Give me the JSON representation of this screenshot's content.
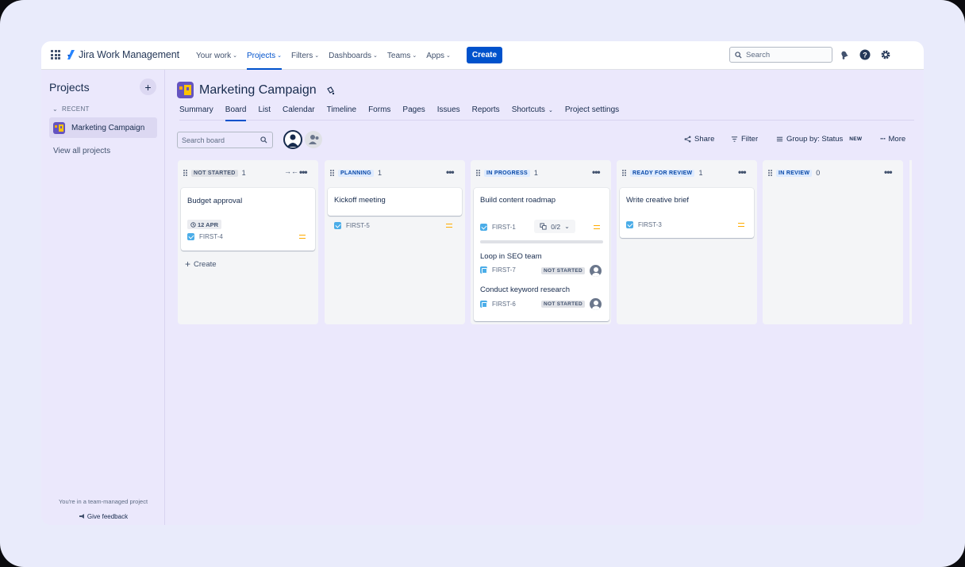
{
  "app": {
    "name": "Jira Work Management"
  },
  "nav": {
    "items": [
      {
        "label": "Your work",
        "chev": "⌄"
      },
      {
        "label": "Projects",
        "chev": "⌄"
      },
      {
        "label": "Filters",
        "chev": "⌄"
      },
      {
        "label": "Dashboards",
        "chev": "⌄"
      },
      {
        "label": "Teams",
        "chev": "⌄"
      },
      {
        "label": "Apps",
        "chev": "⌄"
      }
    ],
    "active": "Projects",
    "create_label": "Create",
    "search_placeholder": "Search"
  },
  "sidebar": {
    "title": "Projects",
    "add_symbol": "+",
    "recent_label": "RECENT",
    "recent_chev": "⌄",
    "project": "Marketing Campaign",
    "view_all": "View all projects",
    "team_note": "You're in a team-managed project",
    "feedback": "Give feedback"
  },
  "project": {
    "title": "Marketing Campaign",
    "tabs": [
      "Summary",
      "Board",
      "List",
      "Calendar",
      "Timeline",
      "Forms",
      "Pages",
      "Issues",
      "Reports",
      "Shortcuts",
      "Project settings"
    ],
    "active_tab": "Board"
  },
  "toolbar": {
    "search_placeholder": "Search board",
    "share": "Share",
    "filter": "Filter",
    "group_by": "Group by: Status",
    "new_badge": "NEW",
    "more": "More"
  },
  "columns": [
    {
      "status": "NOT STARTED",
      "count": "1",
      "style": "grey",
      "cards": [
        {
          "title": "Budget approval",
          "date": "12 APR",
          "key": "FIRST-4"
        }
      ],
      "create_label": "Create"
    },
    {
      "status": "PLANNING",
      "count": "1",
      "style": "blue",
      "cards": [
        {
          "title": "Kickoff meeting",
          "key": "FIRST-5"
        }
      ]
    },
    {
      "status": "IN PROGRESS",
      "count": "1",
      "style": "blue",
      "cards": [
        {
          "title": "Build content roadmap",
          "key": "FIRST-1",
          "children": "0/2",
          "subtasks": [
            {
              "title": "Loop in SEO team",
              "key": "FIRST-7",
              "status": "NOT STARTED"
            },
            {
              "title": "Conduct keyword research",
              "key": "FIRST-6",
              "status": "NOT STARTED"
            }
          ]
        }
      ]
    },
    {
      "status": "READY FOR REVIEW",
      "count": "1",
      "style": "blue",
      "cards": [
        {
          "title": "Write creative brief",
          "key": "FIRST-3"
        }
      ]
    },
    {
      "status": "IN REVIEW",
      "count": "0",
      "style": "blue",
      "cards": []
    }
  ],
  "colors": {
    "brand_blue": "#0052cc",
    "window_bg": "#ebe8fc",
    "column_bg": "#f4f5f7",
    "priority_medium": "#ffab00",
    "project_icon": "#6554c0"
  }
}
